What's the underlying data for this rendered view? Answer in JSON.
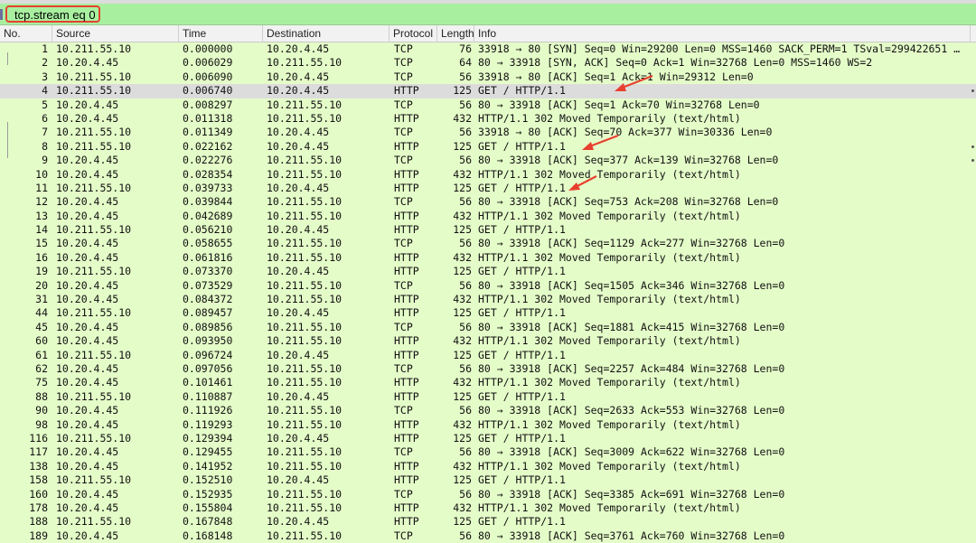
{
  "filter": {
    "value": "tcp.stream eq 0",
    "highlight_color": "#e8402f",
    "bar_color": "#a8f0a0"
  },
  "columns": {
    "no": "No.",
    "source": "Source",
    "time": "Time",
    "destination": "Destination",
    "protocol": "Protocol",
    "length": "Length",
    "info": "Info"
  },
  "row_color": "#e4fcc8",
  "selected_row_color": "#dcdcdc",
  "annotation_color": "#e8402f",
  "packets": [
    {
      "no": "1",
      "source": "10.211.55.10",
      "time": "0.000000",
      "destination": "10.20.4.45",
      "protocol": "TCP",
      "length": "76",
      "info": "33918 → 80 [SYN] Seq=0 Win=29200 Len=0 MSS=1460 SACK_PERM=1 TSval=299422651 TSe…"
    },
    {
      "no": "2",
      "source": "10.20.4.45",
      "time": "0.006029",
      "destination": "10.211.55.10",
      "protocol": "TCP",
      "length": "64",
      "info": "80 → 33918 [SYN, ACK] Seq=0 Ack=1 Win=32768 Len=0 MSS=1460 WS=2"
    },
    {
      "no": "3",
      "source": "10.211.55.10",
      "time": "0.006090",
      "destination": "10.20.4.45",
      "protocol": "TCP",
      "length": "56",
      "info": "33918 → 80 [ACK] Seq=1 Ack=1 Win=29312 Len=0"
    },
    {
      "no": "4",
      "source": "10.211.55.10",
      "time": "0.006740",
      "destination": "10.20.4.45",
      "protocol": "HTTP",
      "length": "125",
      "info": "GET / HTTP/1.1",
      "selected": true
    },
    {
      "no": "5",
      "source": "10.20.4.45",
      "time": "0.008297",
      "destination": "10.211.55.10",
      "protocol": "TCP",
      "length": "56",
      "info": "80 → 33918 [ACK] Seq=1 Ack=70 Win=32768 Len=0"
    },
    {
      "no": "6",
      "source": "10.20.4.45",
      "time": "0.011318",
      "destination": "10.211.55.10",
      "protocol": "HTTP",
      "length": "432",
      "info": "HTTP/1.1 302 Moved Temporarily  (text/html)"
    },
    {
      "no": "7",
      "source": "10.211.55.10",
      "time": "0.011349",
      "destination": "10.20.4.45",
      "protocol": "TCP",
      "length": "56",
      "info": "33918 → 80 [ACK] Seq=70 Ack=377 Win=30336 Len=0"
    },
    {
      "no": "8",
      "source": "10.211.55.10",
      "time": "0.022162",
      "destination": "10.20.4.45",
      "protocol": "HTTP",
      "length": "125",
      "info": "GET / HTTP/1.1"
    },
    {
      "no": "9",
      "source": "10.20.4.45",
      "time": "0.022276",
      "destination": "10.211.55.10",
      "protocol": "TCP",
      "length": "56",
      "info": "80 → 33918 [ACK] Seq=377 Ack=139 Win=32768 Len=0"
    },
    {
      "no": "10",
      "source": "10.20.4.45",
      "time": "0.028354",
      "destination": "10.211.55.10",
      "protocol": "HTTP",
      "length": "432",
      "info": "HTTP/1.1 302 Moved Temporarily  (text/html)"
    },
    {
      "no": "11",
      "source": "10.211.55.10",
      "time": "0.039733",
      "destination": "10.20.4.45",
      "protocol": "HTTP",
      "length": "125",
      "info": "GET / HTTP/1.1"
    },
    {
      "no": "12",
      "source": "10.20.4.45",
      "time": "0.039844",
      "destination": "10.211.55.10",
      "protocol": "TCP",
      "length": "56",
      "info": "80 → 33918 [ACK] Seq=753 Ack=208 Win=32768 Len=0"
    },
    {
      "no": "13",
      "source": "10.20.4.45",
      "time": "0.042689",
      "destination": "10.211.55.10",
      "protocol": "HTTP",
      "length": "432",
      "info": "HTTP/1.1 302 Moved Temporarily  (text/html)"
    },
    {
      "no": "14",
      "source": "10.211.55.10",
      "time": "0.056210",
      "destination": "10.20.4.45",
      "protocol": "HTTP",
      "length": "125",
      "info": "GET / HTTP/1.1"
    },
    {
      "no": "15",
      "source": "10.20.4.45",
      "time": "0.058655",
      "destination": "10.211.55.10",
      "protocol": "TCP",
      "length": "56",
      "info": "80 → 33918 [ACK] Seq=1129 Ack=277 Win=32768 Len=0"
    },
    {
      "no": "16",
      "source": "10.20.4.45",
      "time": "0.061816",
      "destination": "10.211.55.10",
      "protocol": "HTTP",
      "length": "432",
      "info": "HTTP/1.1 302 Moved Temporarily  (text/html)"
    },
    {
      "no": "19",
      "source": "10.211.55.10",
      "time": "0.073370",
      "destination": "10.20.4.45",
      "protocol": "HTTP",
      "length": "125",
      "info": "GET / HTTP/1.1"
    },
    {
      "no": "20",
      "source": "10.20.4.45",
      "time": "0.073529",
      "destination": "10.211.55.10",
      "protocol": "TCP",
      "length": "56",
      "info": "80 → 33918 [ACK] Seq=1505 Ack=346 Win=32768 Len=0"
    },
    {
      "no": "31",
      "source": "10.20.4.45",
      "time": "0.084372",
      "destination": "10.211.55.10",
      "protocol": "HTTP",
      "length": "432",
      "info": "HTTP/1.1 302 Moved Temporarily  (text/html)"
    },
    {
      "no": "44",
      "source": "10.211.55.10",
      "time": "0.089457",
      "destination": "10.20.4.45",
      "protocol": "HTTP",
      "length": "125",
      "info": "GET / HTTP/1.1"
    },
    {
      "no": "45",
      "source": "10.20.4.45",
      "time": "0.089856",
      "destination": "10.211.55.10",
      "protocol": "TCP",
      "length": "56",
      "info": "80 → 33918 [ACK] Seq=1881 Ack=415 Win=32768 Len=0"
    },
    {
      "no": "60",
      "source": "10.20.4.45",
      "time": "0.093950",
      "destination": "10.211.55.10",
      "protocol": "HTTP",
      "length": "432",
      "info": "HTTP/1.1 302 Moved Temporarily  (text/html)"
    },
    {
      "no": "61",
      "source": "10.211.55.10",
      "time": "0.096724",
      "destination": "10.20.4.45",
      "protocol": "HTTP",
      "length": "125",
      "info": "GET / HTTP/1.1"
    },
    {
      "no": "62",
      "source": "10.20.4.45",
      "time": "0.097056",
      "destination": "10.211.55.10",
      "protocol": "TCP",
      "length": "56",
      "info": "80 → 33918 [ACK] Seq=2257 Ack=484 Win=32768 Len=0"
    },
    {
      "no": "75",
      "source": "10.20.4.45",
      "time": "0.101461",
      "destination": "10.211.55.10",
      "protocol": "HTTP",
      "length": "432",
      "info": "HTTP/1.1 302 Moved Temporarily  (text/html)"
    },
    {
      "no": "88",
      "source": "10.211.55.10",
      "time": "0.110887",
      "destination": "10.20.4.45",
      "protocol": "HTTP",
      "length": "125",
      "info": "GET / HTTP/1.1"
    },
    {
      "no": "90",
      "source": "10.20.4.45",
      "time": "0.111926",
      "destination": "10.211.55.10",
      "protocol": "TCP",
      "length": "56",
      "info": "80 → 33918 [ACK] Seq=2633 Ack=553 Win=32768 Len=0"
    },
    {
      "no": "98",
      "source": "10.20.4.45",
      "time": "0.119293",
      "destination": "10.211.55.10",
      "protocol": "HTTP",
      "length": "432",
      "info": "HTTP/1.1 302 Moved Temporarily  (text/html)"
    },
    {
      "no": "116",
      "source": "10.211.55.10",
      "time": "0.129394",
      "destination": "10.20.4.45",
      "protocol": "HTTP",
      "length": "125",
      "info": "GET / HTTP/1.1"
    },
    {
      "no": "117",
      "source": "10.20.4.45",
      "time": "0.129455",
      "destination": "10.211.55.10",
      "protocol": "TCP",
      "length": "56",
      "info": "80 → 33918 [ACK] Seq=3009 Ack=622 Win=32768 Len=0"
    },
    {
      "no": "138",
      "source": "10.20.4.45",
      "time": "0.141952",
      "destination": "10.211.55.10",
      "protocol": "HTTP",
      "length": "432",
      "info": "HTTP/1.1 302 Moved Temporarily  (text/html)"
    },
    {
      "no": "158",
      "source": "10.211.55.10",
      "time": "0.152510",
      "destination": "10.20.4.45",
      "protocol": "HTTP",
      "length": "125",
      "info": "GET / HTTP/1.1"
    },
    {
      "no": "160",
      "source": "10.20.4.45",
      "time": "0.152935",
      "destination": "10.211.55.10",
      "protocol": "TCP",
      "length": "56",
      "info": "80 → 33918 [ACK] Seq=3385 Ack=691 Win=32768 Len=0"
    },
    {
      "no": "178",
      "source": "10.20.4.45",
      "time": "0.155804",
      "destination": "10.211.55.10",
      "protocol": "HTTP",
      "length": "432",
      "info": "HTTP/1.1 302 Moved Temporarily  (text/html)"
    },
    {
      "no": "188",
      "source": "10.211.55.10",
      "time": "0.167848",
      "destination": "10.20.4.45",
      "protocol": "HTTP",
      "length": "125",
      "info": "GET / HTTP/1.1"
    },
    {
      "no": "189",
      "source": "10.20.4.45",
      "time": "0.168148",
      "destination": "10.211.55.10",
      "protocol": "TCP",
      "length": "56",
      "info": "80 → 33918 [ACK] Seq=3761 Ack=760 Win=32768 Len=0"
    }
  ]
}
